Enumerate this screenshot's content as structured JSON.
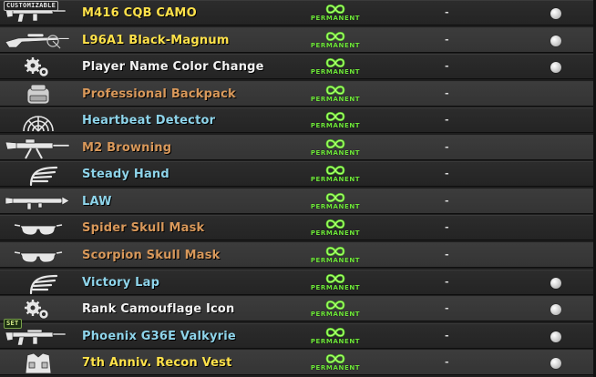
{
  "inventory": {
    "duration_label": "PERMANENT",
    "items": [
      {
        "name": "M416 CQB CAMO",
        "color": "#ffe24a",
        "icon": "rifle-icon",
        "tag": "CUSTOMIZABLE",
        "tag_style": "customizable",
        "status": "-",
        "selectable": true
      },
      {
        "name": "L96A1 Black-Magnum",
        "color": "#ffe24a",
        "icon": "sniper-rifle-icon",
        "tag": "",
        "tag_style": "",
        "status": "-",
        "selectable": true
      },
      {
        "name": "Player Name Color Change",
        "color": "#f2f2f2",
        "icon": "gears-icon",
        "tag": "",
        "tag_style": "",
        "status": "-",
        "selectable": true
      },
      {
        "name": "Professional Backpack",
        "color": "#d8985a",
        "icon": "backpack-icon",
        "tag": "",
        "tag_style": "",
        "status": "-",
        "selectable": false
      },
      {
        "name": "Heartbeat Detector",
        "color": "#8ed4ea",
        "icon": "radar-icon",
        "tag": "",
        "tag_style": "",
        "status": "-",
        "selectable": false
      },
      {
        "name": "M2 Browning",
        "color": "#d8985a",
        "icon": "machine-gun-icon",
        "tag": "",
        "tag_style": "",
        "status": "-",
        "selectable": false
      },
      {
        "name": "Steady Hand",
        "color": "#8ed4ea",
        "icon": "wing-icon",
        "tag": "",
        "tag_style": "",
        "status": "-",
        "selectable": false
      },
      {
        "name": "LAW",
        "color": "#8ed4ea",
        "icon": "launcher-icon",
        "tag": "",
        "tag_style": "",
        "status": "-",
        "selectable": false
      },
      {
        "name": "Spider Skull Mask",
        "color": "#d8985a",
        "icon": "mask-icon",
        "tag": "",
        "tag_style": "",
        "status": "-",
        "selectable": false
      },
      {
        "name": "Scorpion Skull Mask",
        "color": "#d8985a",
        "icon": "mask-icon",
        "tag": "",
        "tag_style": "",
        "status": "-",
        "selectable": false
      },
      {
        "name": "Victory Lap",
        "color": "#8ed4ea",
        "icon": "wing-icon",
        "tag": "",
        "tag_style": "",
        "status": "-",
        "selectable": true
      },
      {
        "name": "Rank Camouflage Icon",
        "color": "#f2f2f2",
        "icon": "gears-icon",
        "tag": "",
        "tag_style": "",
        "status": "-",
        "selectable": true
      },
      {
        "name": "Phoenix G36E Valkyrie",
        "color": "#8ed4ea",
        "icon": "rifle-icon",
        "tag": "SET",
        "tag_style": "set",
        "status": "-",
        "selectable": true
      },
      {
        "name": "7th Anniv. Recon Vest",
        "color": "#ffe24a",
        "icon": "vest-icon",
        "tag": "",
        "tag_style": "",
        "status": "-",
        "selectable": true
      }
    ]
  }
}
